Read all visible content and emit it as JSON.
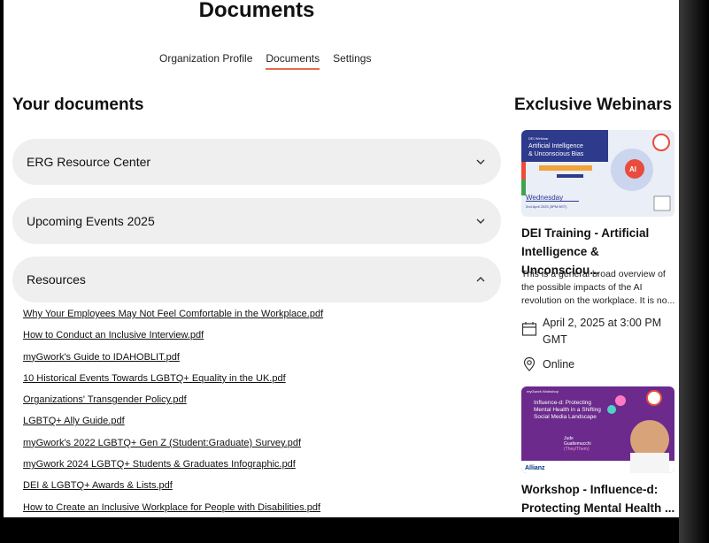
{
  "page": {
    "title": "Documents"
  },
  "tabs": [
    {
      "label": "Organization Profile"
    },
    {
      "label": "Documents"
    },
    {
      "label": "Settings"
    }
  ],
  "documents": {
    "heading": "Your documents",
    "accordions": [
      {
        "label": "ERG Resource Center",
        "state": "collapsed"
      },
      {
        "label": "Upcoming Events 2025",
        "state": "collapsed"
      },
      {
        "label": "Resources",
        "state": "expanded"
      }
    ],
    "files": [
      "Why Your Employees May Not Feel Comfortable in the Workplace.pdf",
      "How to Conduct an Inclusive Interview.pdf",
      "myGwork's Guide to IDAHOBLIT.pdf",
      "10 Historical Events Towards LGBTQ+ Equality in the UK.pdf",
      "Organizations' Transgender Policy.pdf",
      "LGBTQ+ Ally Guide.pdf",
      "myGwork's 2022 LGBTQ+ Gen Z (Student:Graduate) Survey.pdf",
      "myGwork 2024 LGBTQ+ Students & Graduates Infographic.pdf",
      "DEI & LGBTQ+ Awards & Lists.pdf",
      "How to Create an Inclusive Workplace for People with Disabilities.pdf"
    ]
  },
  "webinars": {
    "heading": "Exclusive Webinars",
    "card1": {
      "image_text": {
        "series": "DEI Webinar",
        "title_line1": "Artificial Intelligence",
        "title_line2": "& Unconscious Bias",
        "badge": "AI",
        "day": "Wednesday",
        "date": "2nd April 2025 (3PM BST)"
      },
      "title_line1": "DEI Training - Artificial",
      "title_line2": "Intelligence & Unconsciou...",
      "desc_line1": "This is a general broad overview of",
      "desc_line2": "the possible impacts of the AI",
      "desc_line3": "revolution on the workplace. It is no...",
      "date_line1": "April 2, 2025 at 3:00 PM",
      "date_line2": "GMT",
      "location": "Online"
    },
    "card2": {
      "image_text": {
        "series": "myGwork Workshop",
        "title_line1": "Influence-d: Protecting",
        "title_line2": "Mental Health in a Shifting",
        "title_line3": "Social Media Landscape",
        "speaker": "Jude",
        "speaker2": "Gualtemucchi",
        "pronouns": "(They/Them)",
        "sponsor": "Allianz"
      },
      "title_line1": "Workshop - Influence-d:",
      "title_line2": "Protecting Mental Health ..."
    }
  },
  "colors": {
    "accent": "#e36d4a",
    "accordion_bg": "#efefef",
    "card2_purple": "#6b2a8c",
    "card1_bg": "#e9eef7"
  }
}
